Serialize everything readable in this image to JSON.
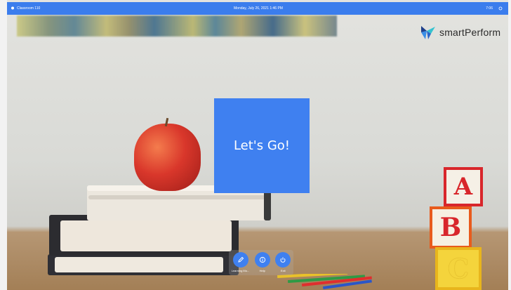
{
  "topbar": {
    "classroom_label": "Classroom 110",
    "datetime": "Monday, July 26, 2021  1:46 PM",
    "sync_label": "7:06",
    "accent_color": "#3b7ded"
  },
  "logo": {
    "text": "smartPerform"
  },
  "main": {
    "cta_label": "Let's Go!",
    "cta_color": "#3f80f0"
  },
  "actions": [
    {
      "label": "Learning Mo...",
      "icon": "pencil-icon"
    },
    {
      "label": "Help",
      "icon": "info-icon"
    },
    {
      "label": "Exit",
      "icon": "power-icon"
    }
  ],
  "blocks": [
    "A",
    "B",
    "C"
  ]
}
